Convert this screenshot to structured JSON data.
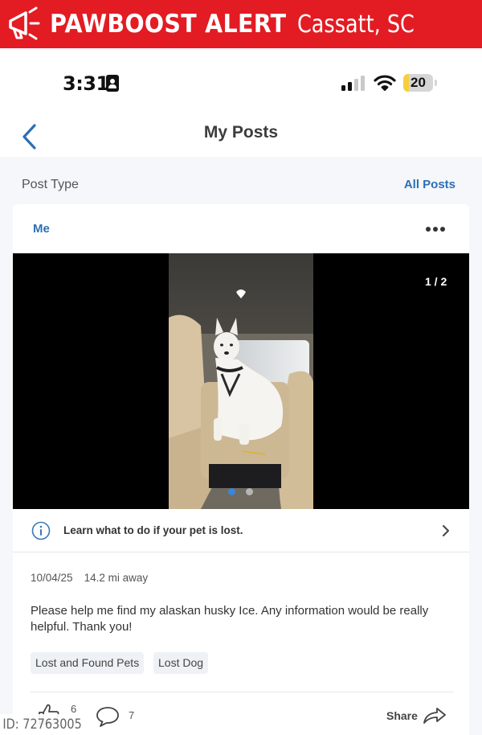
{
  "banner": {
    "brand": "PAWBOOST ALERT",
    "location": "Cassatt, SC",
    "color": "#e31b23",
    "icon": "megaphone-icon"
  },
  "status_bar": {
    "time": "3:31",
    "battery": "20",
    "battery_level": 0.2,
    "signal_bars_active": 2,
    "signal_bars_total": 4
  },
  "nav": {
    "title": "My Posts",
    "back_icon": "chevron-left-icon"
  },
  "filter": {
    "label": "Post Type",
    "value": "All Posts"
  },
  "post": {
    "author": "Me",
    "photo_counter": "1 / 2",
    "photo_count": 2,
    "active_photo": 1,
    "lost_banner": "Learn what to do if your pet is lost.",
    "date": "10/04/25",
    "distance": "14.2 mi away",
    "description": "Please help me find my alaskan husky Ice. Any information would be really helpful. Thank you!",
    "tags": [
      "Lost and Found Pets",
      "Lost Dog"
    ],
    "like_count": "6",
    "comment_count": "7",
    "share_label": "Share"
  },
  "watermark": "ID: 72763005",
  "colors": {
    "accent": "#2e6fb5",
    "banner": "#e31b23",
    "background": "#f5f7fa"
  }
}
